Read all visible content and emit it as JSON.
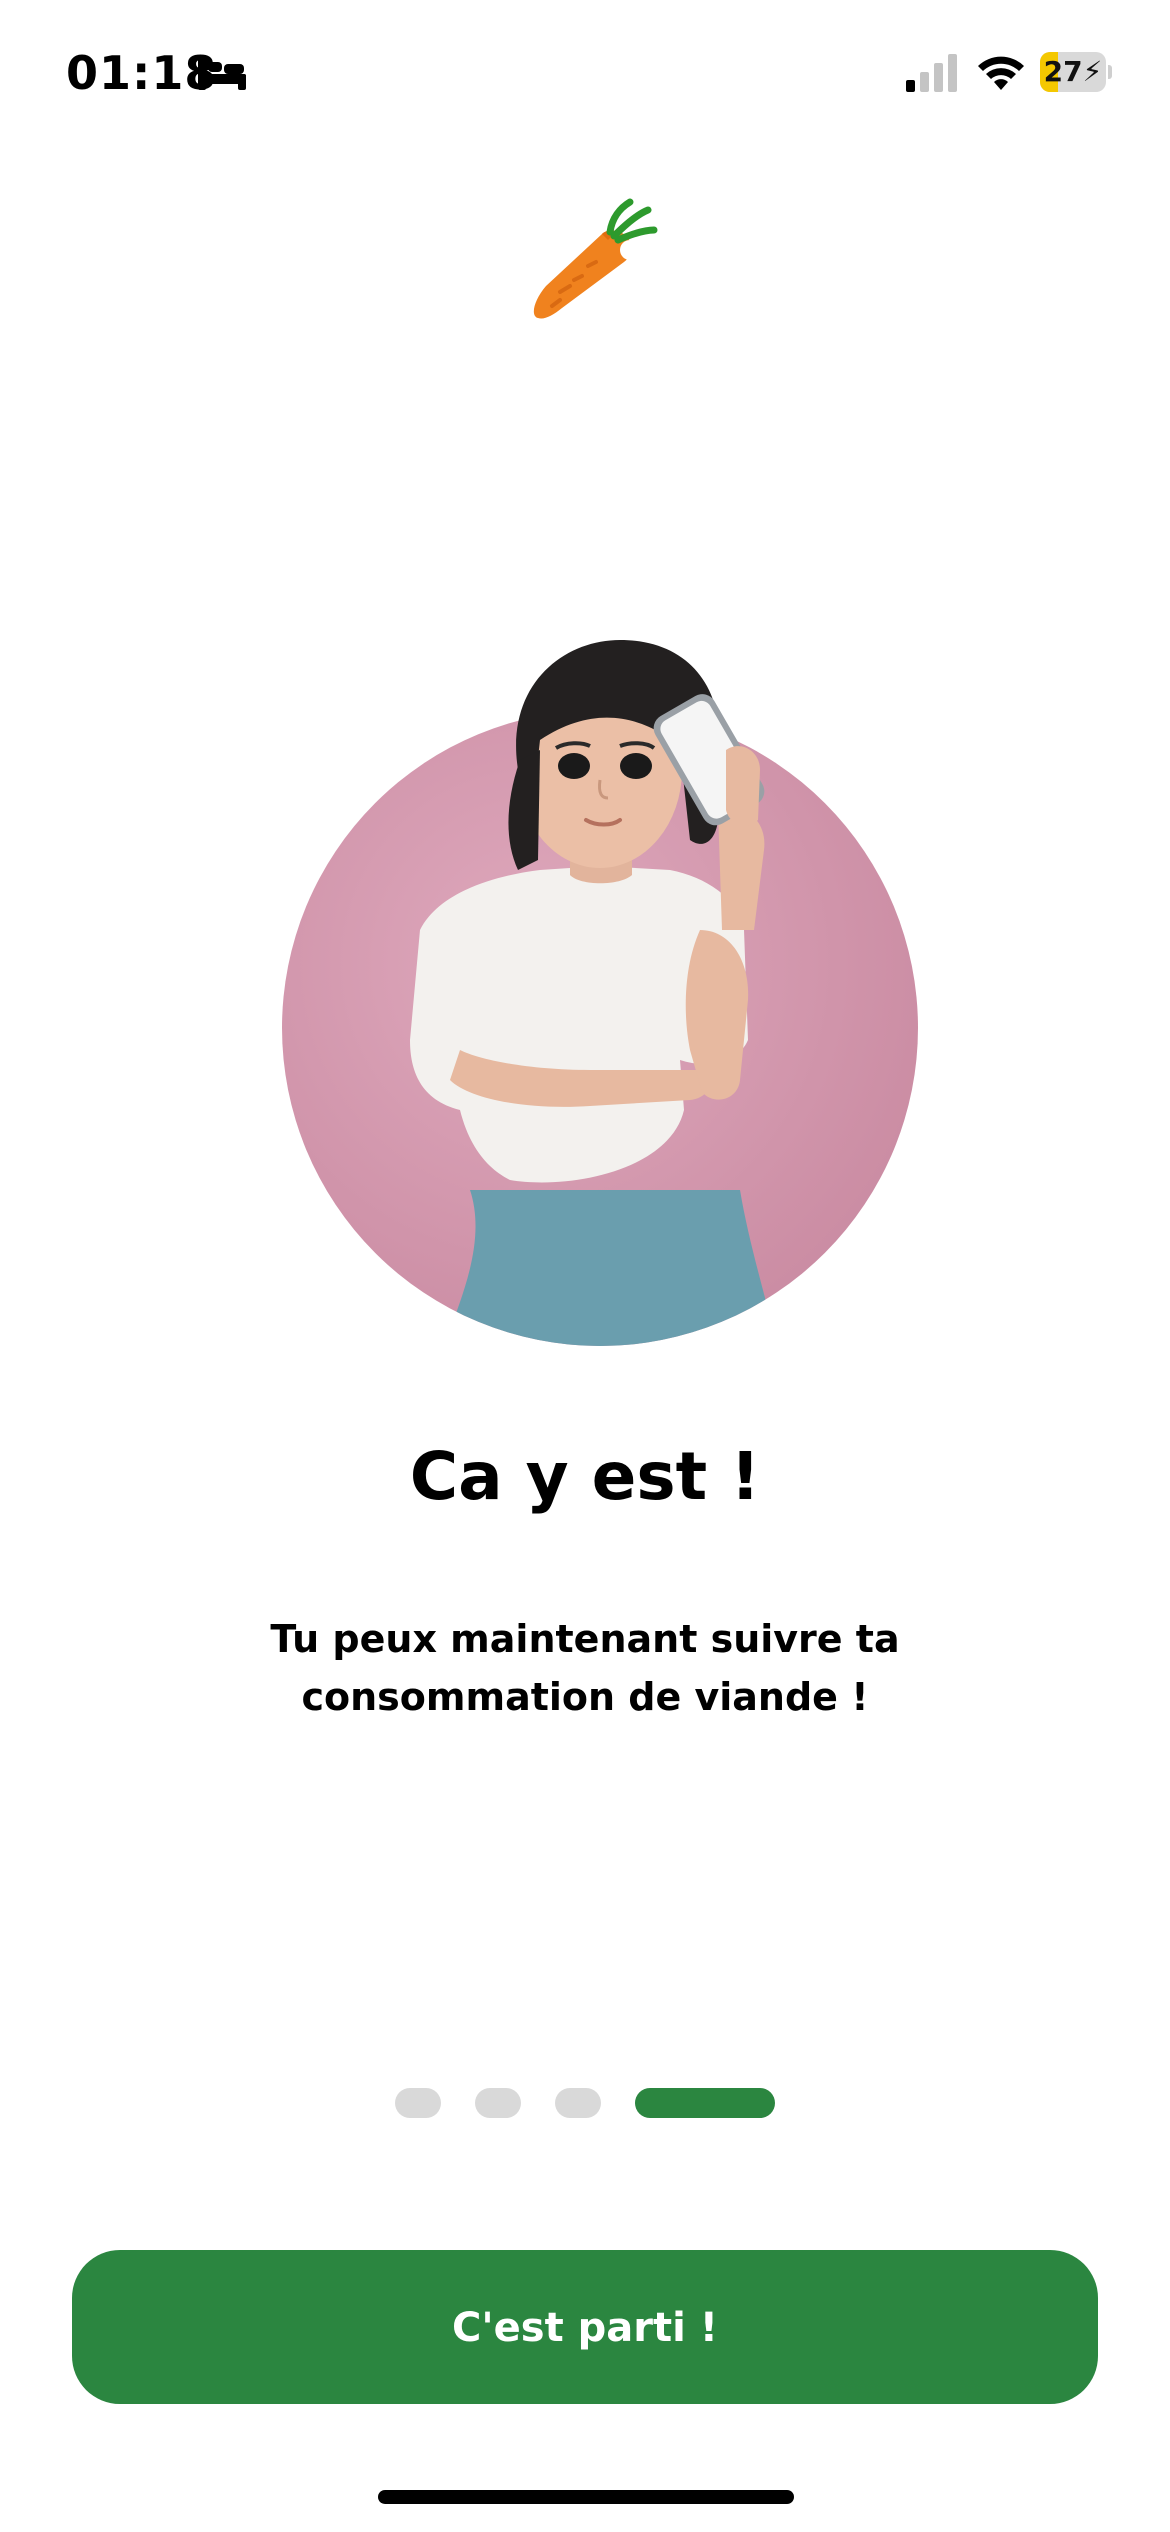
{
  "status_bar": {
    "time": "01:18",
    "battery_level": "27",
    "battery_fraction": 0.27,
    "battery_color": "#f4c800",
    "icons": [
      "bed-icon",
      "cellular-signal-icon",
      "wifi-icon",
      "battery-charging-icon"
    ]
  },
  "logo": {
    "icon": "carrot-icon"
  },
  "illustration": {
    "icon": "woman-with-phone-illustration",
    "background_color": "#d69aaf"
  },
  "content": {
    "title": "Ca y est !",
    "subtitle": "Tu peux maintenant suivre ta consommation de viande !"
  },
  "pager": {
    "total": 4,
    "active_index": 3,
    "active_color": "#2b8640",
    "inactive_color": "#d9d9d9"
  },
  "cta": {
    "label": "C'est parti !",
    "color": "#2b8640"
  }
}
